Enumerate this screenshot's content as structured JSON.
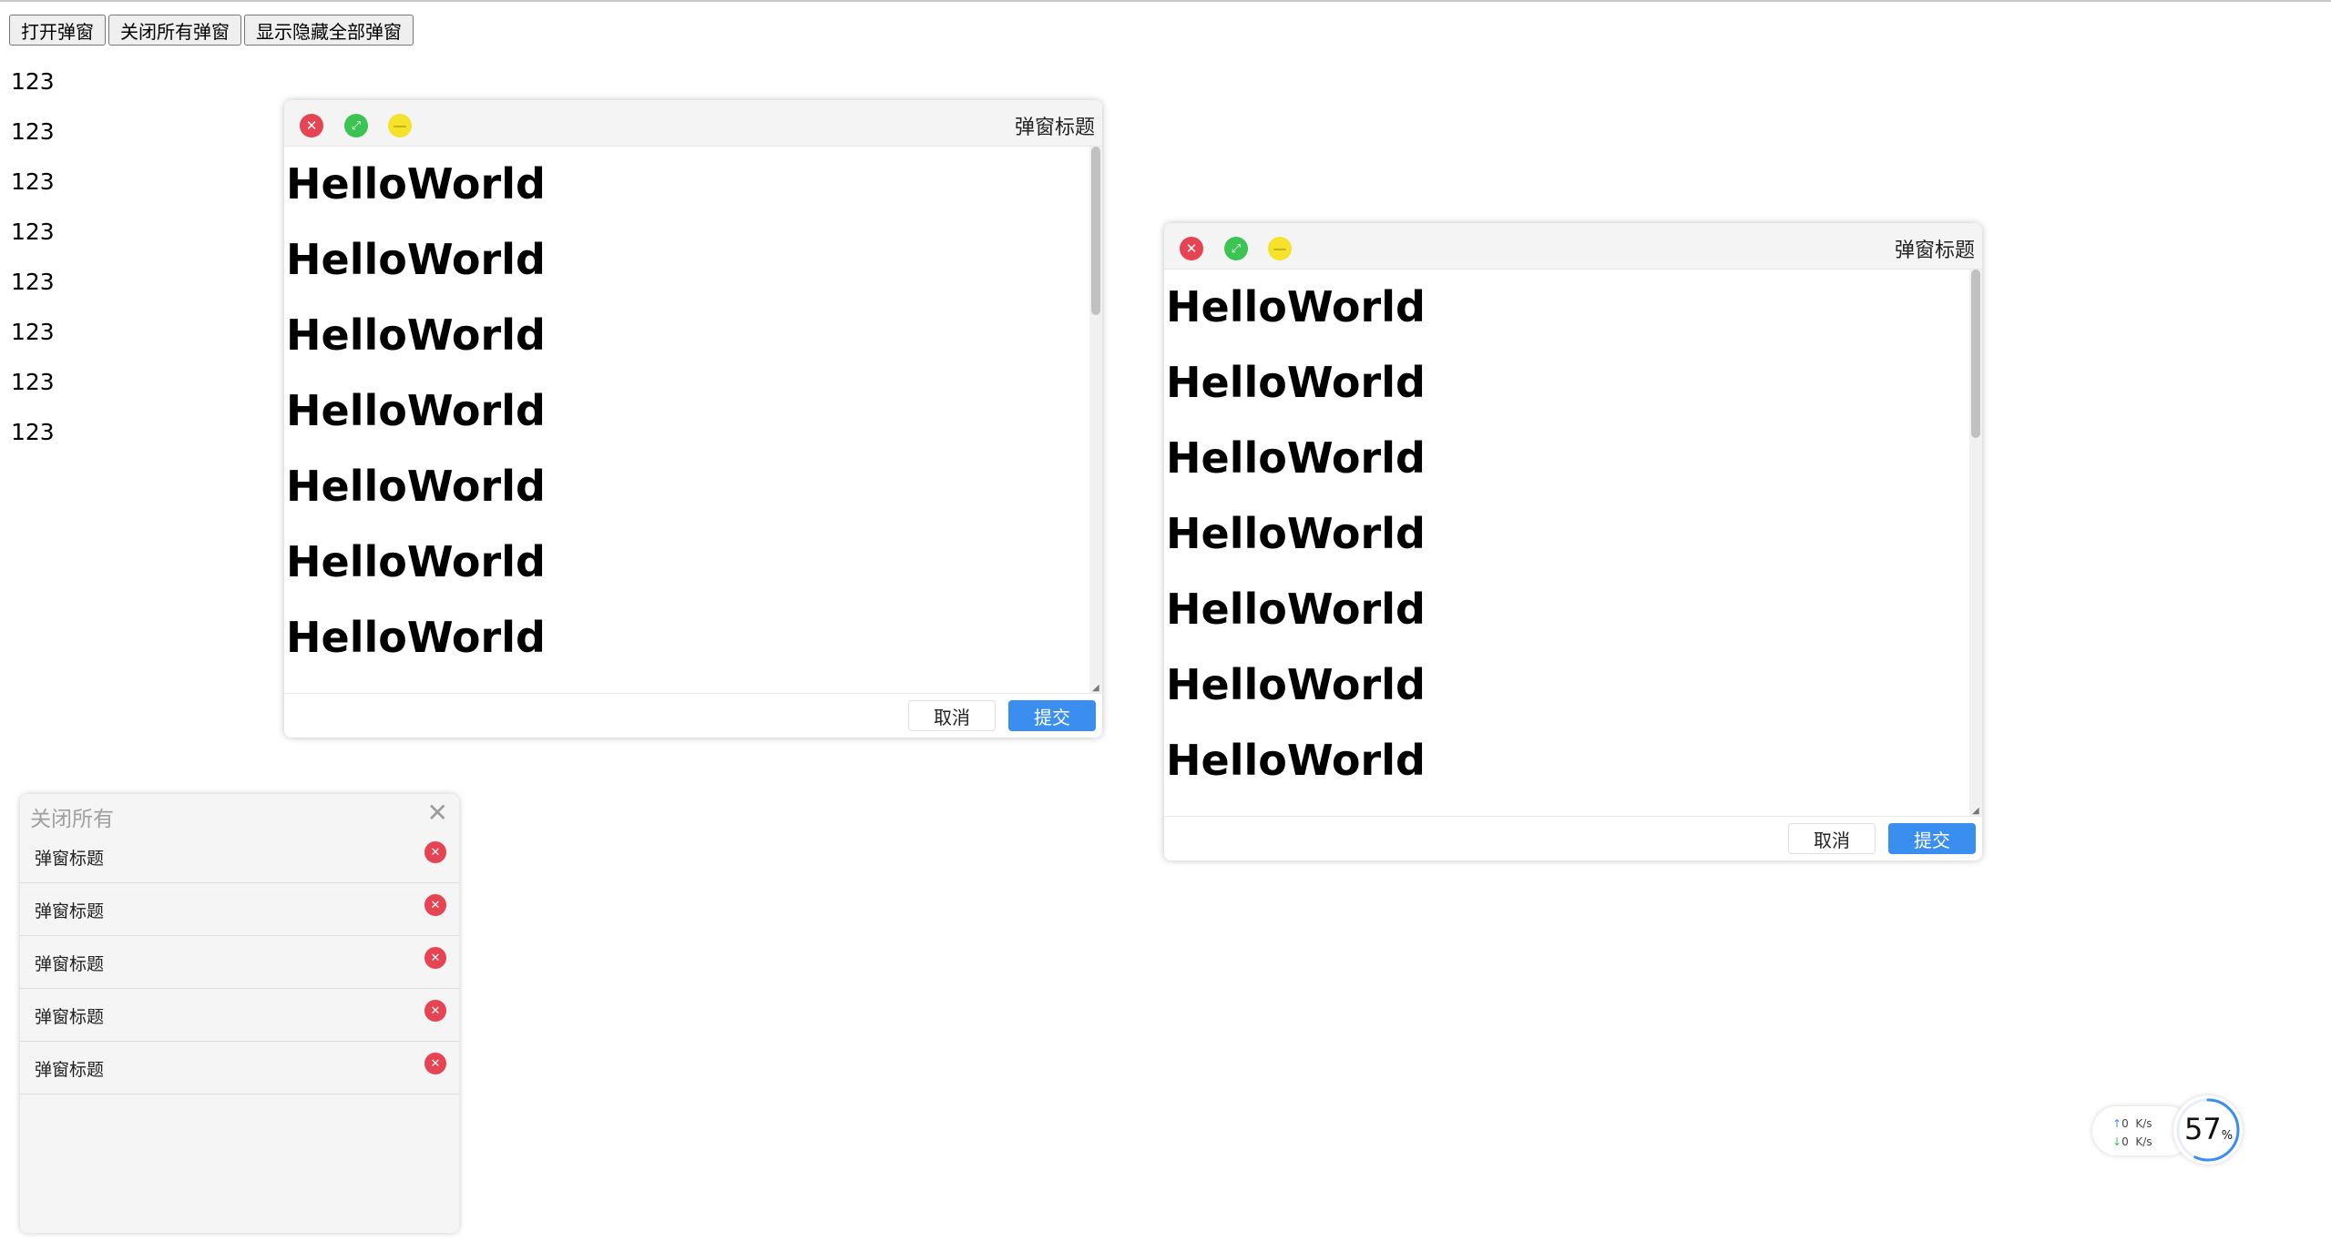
{
  "toolbar": {
    "open_label": "打开弹窗",
    "close_all_label": "关闭所有弹窗",
    "toggle_all_label": "显示隐藏全部弹窗"
  },
  "numbers": [
    "123",
    "123",
    "123",
    "123",
    "123",
    "123",
    "123",
    "123"
  ],
  "modals": [
    {
      "title": "弹窗标题",
      "content": [
        "HelloWorld",
        "HelloWorld",
        "HelloWorld",
        "HelloWorld",
        "HelloWorld",
        "HelloWorld",
        "HelloWorld"
      ],
      "cancel_label": "取消",
      "submit_label": "提交",
      "scroll_position": 0.0
    },
    {
      "title": "弹窗标题",
      "content": [
        "HelloWorld",
        "HelloWorld",
        "HelloWorld",
        "HelloWorld",
        "HelloWorld",
        "HelloWorld",
        "HelloWorld"
      ],
      "cancel_label": "取消",
      "submit_label": "提交",
      "scroll_position": 0.0
    }
  ],
  "window_controls": {
    "close_icon": "close-icon",
    "maximize_icon": "expand-icon",
    "minimize_icon": "minus-icon",
    "close_color": "#e64453",
    "maximize_color": "#3cc453",
    "minimize_color": "#f4e22b"
  },
  "manager": {
    "title": "关闭所有",
    "items": [
      {
        "label": "弹窗标题"
      },
      {
        "label": "弹窗标题"
      },
      {
        "label": "弹窗标题"
      },
      {
        "label": "弹窗标题"
      },
      {
        "label": "弹窗标题"
      }
    ]
  },
  "network_widget": {
    "upload_value": "0",
    "upload_unit": "K/s",
    "download_value": "0",
    "download_unit": "K/s",
    "cpu_percent": 57,
    "cpu_percent_text": "57",
    "percent_sign": "%"
  },
  "colors": {
    "accent": "#3a8ef0",
    "danger": "#e64453"
  }
}
